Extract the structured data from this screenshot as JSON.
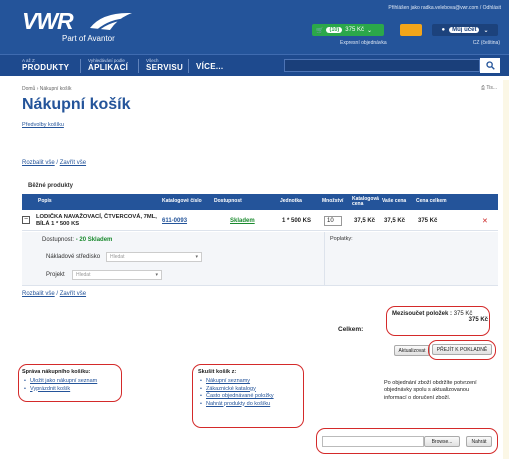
{
  "header": {
    "logo_text": "VWR",
    "logo_subtitle": "Part of Avantor",
    "top_links": "Přihlášen jako radka.velebova@vwr.com / Odhlásit",
    "cart": {
      "count": "(10)",
      "total": "375 Kč"
    },
    "user_button": "Můj účet",
    "express_link": "Expresní objednávka",
    "cz_link": "CZ (čeština)"
  },
  "nav": {
    "items": [
      {
        "small": "A až Z",
        "big": "PRODUKTY"
      },
      {
        "small": "Vyhledávání podle",
        "big": "APLIKACÍ"
      },
      {
        "small": "Všech",
        "big": "SERVISU"
      },
      {
        "small": "",
        "big": "VÍCE..."
      }
    ]
  },
  "page": {
    "breadcrumb": "Domů › Nákupní košík",
    "print_label": "Tis...",
    "title": "Nákupní košík",
    "preferences_link": "Předvolby košíku",
    "expand_all": "Rozbalit vše",
    "collapse_all": "Zavřít vše",
    "separator": "/",
    "section_title": "Běžné produkty"
  },
  "table": {
    "columns": [
      "Popis",
      "Katalogové číslo",
      "Dostupnost",
      "Jednotka",
      "Množství",
      "Katalogová cena",
      "Vaše cena",
      "Cena celkem"
    ],
    "rows": [
      {
        "description": "LODIČKA NAVAŽOVACÍ, ČTVERCOVÁ, 7ML, BÍLÁ 1 * 500 KS",
        "catalog_no": "611-0093",
        "availability": "Skladem",
        "unit": "1 * 500 KS",
        "quantity": "10",
        "list_price": "37,5 Kč",
        "your_price": "37,5 Kč",
        "total": "375 Kč"
      }
    ]
  },
  "details": {
    "availability_label": "Dostupnost:",
    "availability_value": "- 20 Skladem",
    "cost_center_label": "Nákladové středisko",
    "cost_center_placeholder": "Hledat",
    "project_label": "Projekt",
    "project_placeholder": "Hledat",
    "fees_label": "Poplatky:"
  },
  "summary": {
    "subtotal_label": "Mezisoučet položek :",
    "subtotal_value": "375 Kč",
    "subtotal_value2": "375 Kč",
    "total_label": "Celkem:",
    "update_button": "Aktualizovat",
    "checkout_button": "PŘEJÍT K POKLADNĚ"
  },
  "manage": {
    "title": "Správa nákupního košíku:",
    "links": [
      "Uložit jako nákupní seznam",
      "Vyprázdnit košík"
    ]
  },
  "fill": {
    "title": "Skušit košík z:",
    "links": [
      "Nákupní seznamy",
      "Zákaznické katalogy",
      "Často objednávané položky",
      "Nahrát produkty do košíku"
    ]
  },
  "note": "Po objednání zboží obdržíte potvrzení objednávky spolu s aktualizovanou informací o doručení zboží.",
  "upload": {
    "browse_button": "Browse...",
    "upload_button": "Nahrát"
  },
  "colors": {
    "header_blue": "#24549a",
    "nav_blue": "#1e4a8e",
    "cart_green": "#2ba84a",
    "alert_orange": "#f2a51a",
    "highlight_red": "#d42a2a",
    "stock_green": "#1a8a2e"
  }
}
